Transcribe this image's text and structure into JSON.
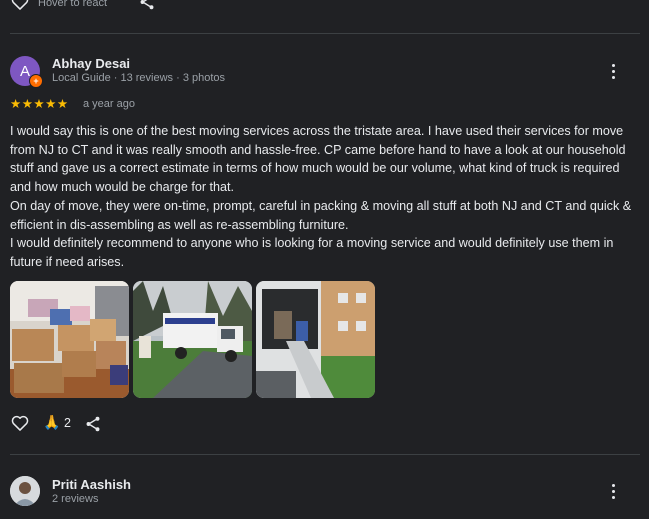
{
  "prev_review": {
    "hover_label": "Hover to react"
  },
  "review": {
    "avatar_letter": "A",
    "avatar_color": "#7e57c2",
    "reviewer_name": "Abhay Desai",
    "reviewer_meta": "Local Guide · 13 reviews · 3 photos",
    "stars": "★★★★★",
    "date": "a year ago",
    "paragraphs": [
      "I would say this is one of the best moving services across the tristate area. I have used their services for move from NJ to CT and it was really smooth and hassle-free. CP came before hand to have a look at our household stuff and gave us a correct estimate in terms of how much would be our volume, what kind of truck is required and how much would be charge for that.",
      "On day of move, they were on-time, prompt, careful in packing & moving all stuff at both NJ and CT and quick & efficient in dis-assembling as well as re-assembling furniture.",
      "I would definitely recommend to anyone who is looking for a moving service and would definitely use them in future if need arises."
    ],
    "reaction_count": "2",
    "photos": [
      "moving-boxes-photo",
      "moving-truck-photo",
      "truck-ramp-photo"
    ]
  },
  "next_review": {
    "reviewer_name": "Priti Aashish",
    "reviewer_meta": "2 reviews"
  },
  "colors": {
    "background": "#202124",
    "star": "#fbbc04",
    "muted_text": "#9aa0a6",
    "divider": "#3c4043"
  }
}
